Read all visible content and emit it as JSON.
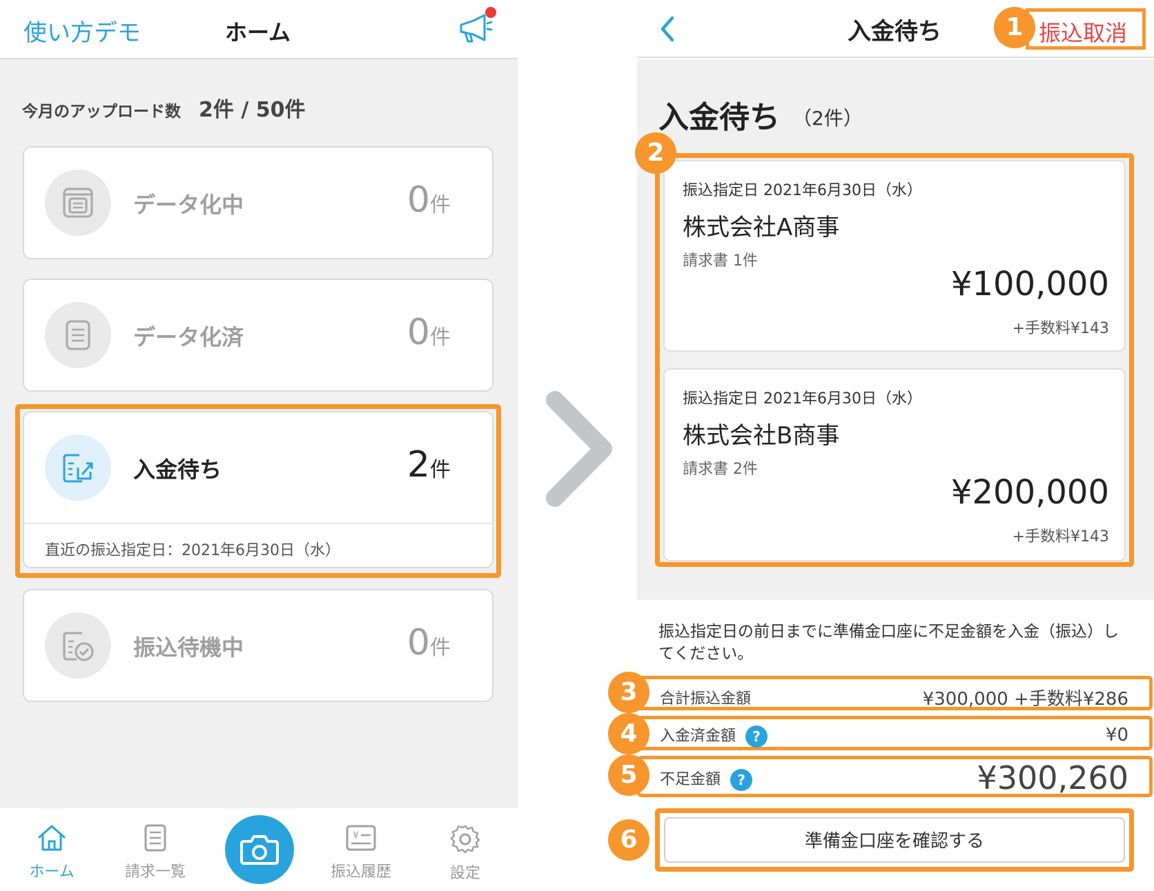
{
  "left": {
    "header": {
      "demo_link": "使い方デモ",
      "title": "ホーム"
    },
    "uploads": {
      "label": "今月のアップロード数",
      "count": "2件 / 50件"
    },
    "cards": [
      {
        "label": "データ化中",
        "count": "0",
        "unit": "件"
      },
      {
        "label": "データ化済",
        "count": "0",
        "unit": "件"
      },
      {
        "label": "入金待ち",
        "count": "2",
        "unit": "件",
        "recent": "直近の振込指定日：2021年6月30日（水）"
      },
      {
        "label": "振込待機中",
        "count": "0",
        "unit": "件"
      }
    ],
    "tabs": [
      {
        "label": "ホーム",
        "icon": "home-icon"
      },
      {
        "label": "請求一覧",
        "icon": "invoice-list-icon"
      },
      {
        "label": "",
        "icon": "camera-icon"
      },
      {
        "label": "振込履歴",
        "icon": "transfer-history-icon"
      },
      {
        "label": "設定",
        "icon": "settings-icon"
      }
    ]
  },
  "right": {
    "header": {
      "title": "入金待ち",
      "cancel": "振込取消"
    },
    "heading": "入金待ち",
    "heading_count": "（2件）",
    "payments": [
      {
        "date": "振込指定日 2021年6月30日（水）",
        "company": "株式会社A商事",
        "invoices": "請求書 1件",
        "amount": "¥100,000",
        "fee": "+手数料¥143"
      },
      {
        "date": "振込指定日 2021年6月30日（水）",
        "company": "株式会社B商事",
        "invoices": "請求書 2件",
        "amount": "¥200,000",
        "fee": "+手数料¥143"
      }
    ],
    "notice": "振込指定日の前日までに準備金口座に不足金額を入金（振込）してください。",
    "summary": {
      "total_label": "合計振込金額",
      "total_value": "¥300,000 +手数料¥286",
      "paid_label": "入金済金額",
      "paid_value": "¥0",
      "short_label": "不足金額",
      "short_value": "¥300,260"
    },
    "confirm_button": "準備金口座を確認する"
  },
  "badges": [
    "1",
    "2",
    "3",
    "4",
    "5",
    "6"
  ],
  "colors": {
    "accent_blue": "#29a3de",
    "highlight_orange": "#f7962d",
    "cancel_red": "#e94545",
    "notification_red": "#ea3b3b"
  }
}
